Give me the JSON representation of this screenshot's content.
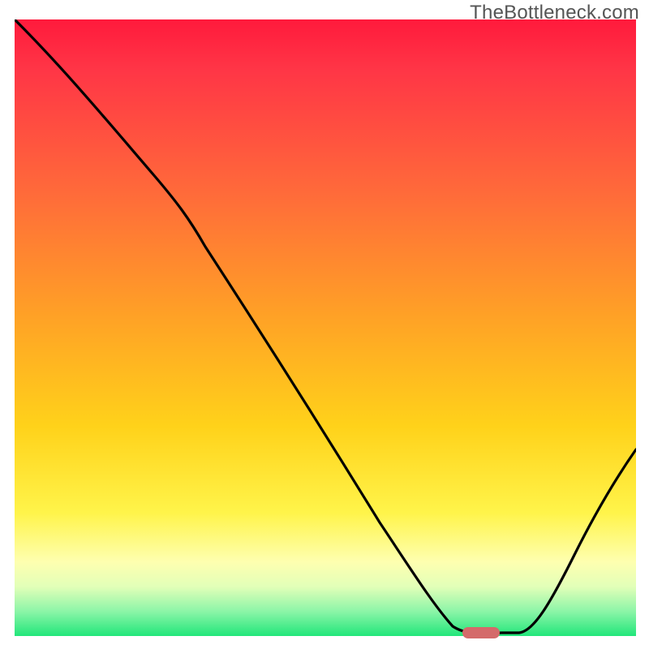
{
  "watermark": "TheBottleneck.com",
  "chart_data": {
    "type": "line",
    "title": "",
    "xlabel": "",
    "ylabel": "",
    "xlim": [
      0,
      100
    ],
    "ylim": [
      0,
      100
    ],
    "grid": false,
    "legend": false,
    "background_gradient": {
      "stops": [
        {
          "pos": 0,
          "color": "#ff1a3c"
        },
        {
          "pos": 28,
          "color": "#ff6a3a"
        },
        {
          "pos": 66,
          "color": "#ffd21a"
        },
        {
          "pos": 88,
          "color": "#feffb0"
        },
        {
          "pos": 100,
          "color": "#21e67a"
        }
      ]
    },
    "series": [
      {
        "name": "bottleneck-curve",
        "color": "#000000",
        "x": [
          0,
          12,
          20,
          30,
          40,
          50,
          60,
          68,
          72,
          76,
          80,
          88,
          100
        ],
        "y": [
          100,
          88,
          78,
          64,
          50,
          36,
          22,
          10,
          4,
          1,
          1,
          10,
          28
        ]
      }
    ],
    "marker": {
      "name": "optimal-point",
      "x": 75,
      "y": 0.5,
      "color": "#d46a6a"
    }
  }
}
